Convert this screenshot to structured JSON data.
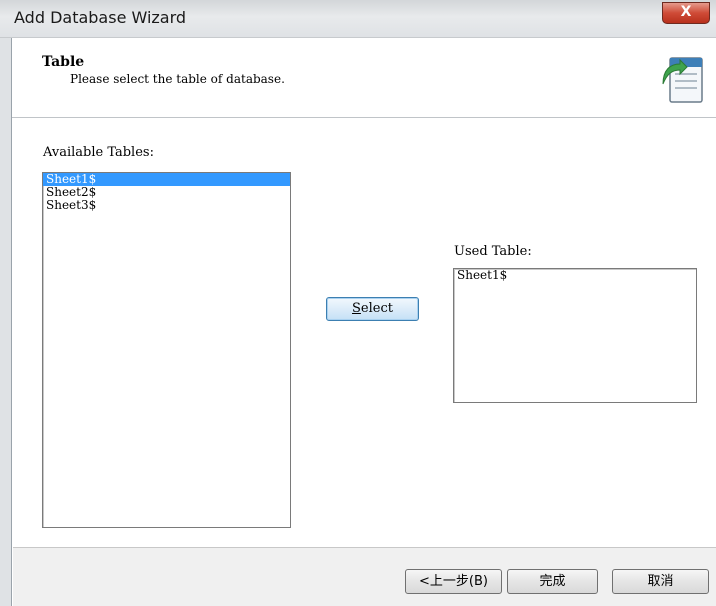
{
  "window": {
    "title": "Add Database Wizard",
    "close_glyph": "X"
  },
  "header": {
    "title": "Table",
    "subtitle": "Please select the table of database.",
    "icon": "database-table-icon"
  },
  "available": {
    "label": "Available Tables:",
    "items": [
      "Sheet1$",
      "Sheet2$",
      "Sheet3$"
    ],
    "selected_index": 0
  },
  "select_button": {
    "label": "Select",
    "mnemonic": "S"
  },
  "used": {
    "label": "Used Table:",
    "items": [
      "Sheet1$"
    ]
  },
  "footer": {
    "back_label": "<上一步(B)",
    "finish_label": "完成",
    "cancel_label": "取消"
  },
  "colors": {
    "selection": "#3399ff",
    "close_button": "#cf4b37",
    "select_button_border": "#3c7fb1"
  }
}
